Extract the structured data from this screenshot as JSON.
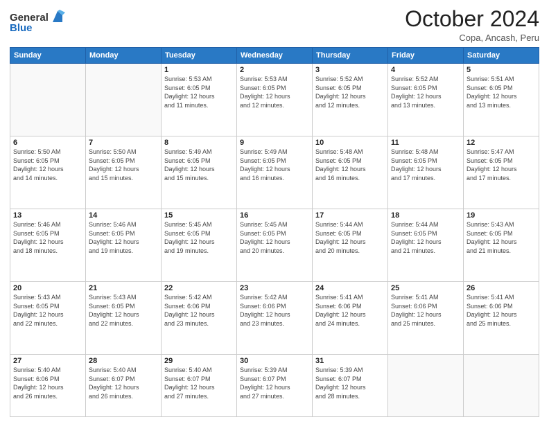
{
  "logo": {
    "general": "General",
    "blue": "Blue"
  },
  "title": {
    "month": "October 2024",
    "location": "Copa, Ancash, Peru"
  },
  "days_of_week": [
    "Sunday",
    "Monday",
    "Tuesday",
    "Wednesday",
    "Thursday",
    "Friday",
    "Saturday"
  ],
  "weeks": [
    [
      {
        "day": "",
        "info": ""
      },
      {
        "day": "",
        "info": ""
      },
      {
        "day": "1",
        "info": "Sunrise: 5:53 AM\nSunset: 6:05 PM\nDaylight: 12 hours\nand 11 minutes."
      },
      {
        "day": "2",
        "info": "Sunrise: 5:53 AM\nSunset: 6:05 PM\nDaylight: 12 hours\nand 12 minutes."
      },
      {
        "day": "3",
        "info": "Sunrise: 5:52 AM\nSunset: 6:05 PM\nDaylight: 12 hours\nand 12 minutes."
      },
      {
        "day": "4",
        "info": "Sunrise: 5:52 AM\nSunset: 6:05 PM\nDaylight: 12 hours\nand 13 minutes."
      },
      {
        "day": "5",
        "info": "Sunrise: 5:51 AM\nSunset: 6:05 PM\nDaylight: 12 hours\nand 13 minutes."
      }
    ],
    [
      {
        "day": "6",
        "info": "Sunrise: 5:50 AM\nSunset: 6:05 PM\nDaylight: 12 hours\nand 14 minutes."
      },
      {
        "day": "7",
        "info": "Sunrise: 5:50 AM\nSunset: 6:05 PM\nDaylight: 12 hours\nand 15 minutes."
      },
      {
        "day": "8",
        "info": "Sunrise: 5:49 AM\nSunset: 6:05 PM\nDaylight: 12 hours\nand 15 minutes."
      },
      {
        "day": "9",
        "info": "Sunrise: 5:49 AM\nSunset: 6:05 PM\nDaylight: 12 hours\nand 16 minutes."
      },
      {
        "day": "10",
        "info": "Sunrise: 5:48 AM\nSunset: 6:05 PM\nDaylight: 12 hours\nand 16 minutes."
      },
      {
        "day": "11",
        "info": "Sunrise: 5:48 AM\nSunset: 6:05 PM\nDaylight: 12 hours\nand 17 minutes."
      },
      {
        "day": "12",
        "info": "Sunrise: 5:47 AM\nSunset: 6:05 PM\nDaylight: 12 hours\nand 17 minutes."
      }
    ],
    [
      {
        "day": "13",
        "info": "Sunrise: 5:46 AM\nSunset: 6:05 PM\nDaylight: 12 hours\nand 18 minutes."
      },
      {
        "day": "14",
        "info": "Sunrise: 5:46 AM\nSunset: 6:05 PM\nDaylight: 12 hours\nand 19 minutes."
      },
      {
        "day": "15",
        "info": "Sunrise: 5:45 AM\nSunset: 6:05 PM\nDaylight: 12 hours\nand 19 minutes."
      },
      {
        "day": "16",
        "info": "Sunrise: 5:45 AM\nSunset: 6:05 PM\nDaylight: 12 hours\nand 20 minutes."
      },
      {
        "day": "17",
        "info": "Sunrise: 5:44 AM\nSunset: 6:05 PM\nDaylight: 12 hours\nand 20 minutes."
      },
      {
        "day": "18",
        "info": "Sunrise: 5:44 AM\nSunset: 6:05 PM\nDaylight: 12 hours\nand 21 minutes."
      },
      {
        "day": "19",
        "info": "Sunrise: 5:43 AM\nSunset: 6:05 PM\nDaylight: 12 hours\nand 21 minutes."
      }
    ],
    [
      {
        "day": "20",
        "info": "Sunrise: 5:43 AM\nSunset: 6:05 PM\nDaylight: 12 hours\nand 22 minutes."
      },
      {
        "day": "21",
        "info": "Sunrise: 5:43 AM\nSunset: 6:05 PM\nDaylight: 12 hours\nand 22 minutes."
      },
      {
        "day": "22",
        "info": "Sunrise: 5:42 AM\nSunset: 6:06 PM\nDaylight: 12 hours\nand 23 minutes."
      },
      {
        "day": "23",
        "info": "Sunrise: 5:42 AM\nSunset: 6:06 PM\nDaylight: 12 hours\nand 23 minutes."
      },
      {
        "day": "24",
        "info": "Sunrise: 5:41 AM\nSunset: 6:06 PM\nDaylight: 12 hours\nand 24 minutes."
      },
      {
        "day": "25",
        "info": "Sunrise: 5:41 AM\nSunset: 6:06 PM\nDaylight: 12 hours\nand 25 minutes."
      },
      {
        "day": "26",
        "info": "Sunrise: 5:41 AM\nSunset: 6:06 PM\nDaylight: 12 hours\nand 25 minutes."
      }
    ],
    [
      {
        "day": "27",
        "info": "Sunrise: 5:40 AM\nSunset: 6:06 PM\nDaylight: 12 hours\nand 26 minutes."
      },
      {
        "day": "28",
        "info": "Sunrise: 5:40 AM\nSunset: 6:07 PM\nDaylight: 12 hours\nand 26 minutes."
      },
      {
        "day": "29",
        "info": "Sunrise: 5:40 AM\nSunset: 6:07 PM\nDaylight: 12 hours\nand 27 minutes."
      },
      {
        "day": "30",
        "info": "Sunrise: 5:39 AM\nSunset: 6:07 PM\nDaylight: 12 hours\nand 27 minutes."
      },
      {
        "day": "31",
        "info": "Sunrise: 5:39 AM\nSunset: 6:07 PM\nDaylight: 12 hours\nand 28 minutes."
      },
      {
        "day": "",
        "info": ""
      },
      {
        "day": "",
        "info": ""
      }
    ]
  ]
}
